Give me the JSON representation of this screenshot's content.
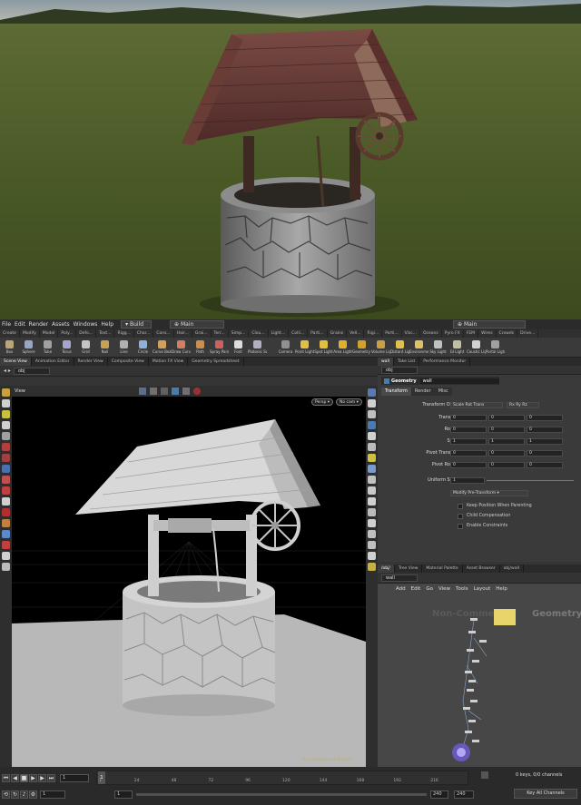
{
  "menubar": {
    "items": [
      "File",
      "Edit",
      "Render",
      "Assets",
      "Windows",
      "Help"
    ],
    "desktop_left": "Build",
    "desktop_mid": "Main",
    "desktop_right": "Main"
  },
  "shelf_tabs": [
    "Create",
    "Modify",
    "Model",
    "Poly...",
    "Defo...",
    "Text...",
    "Rigg...",
    "Char...",
    "Cons...",
    "Hair...",
    "Grai...",
    "Terr...",
    "Simp...",
    "Clou...",
    "Light...",
    "Colli...",
    "Parti...",
    "Grains",
    "Vell...",
    "Rigi...",
    "Parti...",
    "Visc...",
    "Oceans",
    "Pyro FX",
    "FEM",
    "Wires",
    "Crowds",
    "Drive..."
  ],
  "shelf_tools": [
    {
      "label": "Box",
      "color": "#b9a77a"
    },
    {
      "label": "Sphere",
      "color": "#9aa4c6"
    },
    {
      "label": "Tube",
      "color": "#a0a0a0"
    },
    {
      "label": "Torus",
      "color": "#a4a4d0"
    },
    {
      "label": "Grid",
      "color": "#c4c4c4"
    },
    {
      "label": "Null",
      "color": "#c8a050"
    },
    {
      "label": "Line",
      "color": "#b0b0b0"
    },
    {
      "label": "Circle",
      "color": "#8fb0d8"
    },
    {
      "label": "Curve Bezier",
      "color": "#d0a060"
    },
    {
      "label": "Draw Curve",
      "color": "#d08060"
    },
    {
      "label": "Path",
      "color": "#c89050"
    },
    {
      "label": "Spray Paint",
      "color": "#d06060"
    },
    {
      "label": "Font",
      "color": "#dddddd"
    },
    {
      "label": "Platonic Solids",
      "color": "#b0b0c0"
    },
    {
      "label": "Camera",
      "color": "#909090"
    },
    {
      "label": "Point Light",
      "color": "#e0c040"
    },
    {
      "label": "Spot Light",
      "color": "#e0c040"
    },
    {
      "label": "Area Light",
      "color": "#e0b030"
    },
    {
      "label": "Geometry Light",
      "color": "#d0a030"
    },
    {
      "label": "Volume Light",
      "color": "#c8a040"
    },
    {
      "label": "Distant Light",
      "color": "#e0c050"
    },
    {
      "label": "Environment Light",
      "color": "#e0c060"
    },
    {
      "label": "Sky Light",
      "color": "#c0c0c0"
    },
    {
      "label": "GI Light",
      "color": "#c0c0a0"
    },
    {
      "label": "Caustic Light",
      "color": "#d0d0d0"
    },
    {
      "label": "Portal Light",
      "color": "#a0a0a0"
    }
  ],
  "left_pane": {
    "tabs": [
      "Scene View",
      "Animation Editor",
      "Render View",
      "Composite View",
      "Motion FX View",
      "Geometry Spreadsheet"
    ],
    "path": "obj",
    "view_label": "View",
    "persp": "Persp",
    "cam": "No cam",
    "watermark": "Non-Commercial Edition"
  },
  "right_pane": {
    "tabs": [
      "wall",
      "Take List",
      "Performance Monitor"
    ],
    "path": "obj",
    "node_type": "Geometry",
    "node_name": "wall",
    "param_tabs": [
      "Transform",
      "Render",
      "Misc"
    ],
    "transform_order_label": "Transform Order",
    "transform_order_value": "Scale Rot Trans",
    "rot_order_value": "Rx Ry Rz",
    "rows": [
      {
        "label": "Translate",
        "values": [
          "0",
          "0",
          "0"
        ]
      },
      {
        "label": "Rotate",
        "values": [
          "0",
          "0",
          "0"
        ]
      },
      {
        "label": "Scale",
        "values": [
          "1",
          "1",
          "1"
        ]
      },
      {
        "label": "Pivot Translate",
        "values": [
          "0",
          "0",
          "0"
        ]
      },
      {
        "label": "Pivot Rotate",
        "values": [
          "0",
          "0",
          "0"
        ]
      }
    ],
    "uniform_scale_label": "Uniform Scale",
    "uniform_scale_value": "1",
    "modify_pretransform": "Modify Pre-Transform",
    "checkboxes": [
      "Keep Position When Parenting",
      "Child Compensation",
      "Enable Constraints"
    ]
  },
  "network_pane": {
    "tabs": [
      "/obj/",
      "Tree View",
      "Material Palette",
      "Asset Browser",
      "obj/wall"
    ],
    "path": "wall",
    "menu": [
      "Add",
      "Edit",
      "Go",
      "View",
      "Tools",
      "Layout",
      "Help"
    ],
    "watermark_left": "Non-Commercial",
    "watermark_right": "Geometry"
  },
  "timeline": {
    "current_frame": "1",
    "start": "1",
    "start2": "1",
    "end": "240",
    "end2": "240",
    "ticks": [
      "1",
      "24",
      "48",
      "72",
      "96",
      "120",
      "144",
      "168",
      "192",
      "216"
    ],
    "keys_info": "0 keys, 0/0 channels",
    "key_all": "Key All Channels"
  },
  "colors": {
    "accent": "#e0c040",
    "background": "#353535",
    "viewport": "#000000"
  }
}
